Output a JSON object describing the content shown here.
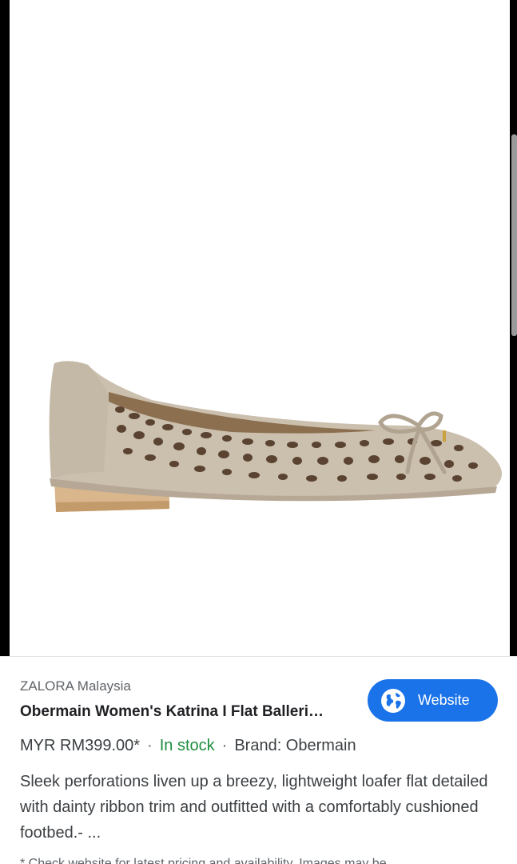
{
  "product_image": {
    "alt": "Obermain Women's Katrina I Flat Ballerina"
  },
  "listing": {
    "seller": "ZALORA Malaysia",
    "title": "Obermain Women's Katrina I Flat Balleri…",
    "website_button_label": "Website",
    "price": "MYR RM399.00*",
    "separator": "·",
    "stock_status": "In stock",
    "brand": "Brand: Obermain",
    "description": "Sleek perforations liven up a breezy, lightweight loafer flat detailed with dainty ribbon trim and outfitted with a comfortably cushioned footbed.- ...",
    "disclaimer": "* Check website for latest pricing and availability. Images may be"
  },
  "icons": {
    "website": "globe-icon"
  },
  "colors": {
    "button_bg": "#1a73e8",
    "in_stock": "#1e8e3e",
    "shoe_leather": "#cbbfae",
    "shoe_heel": "#d6b48c"
  }
}
